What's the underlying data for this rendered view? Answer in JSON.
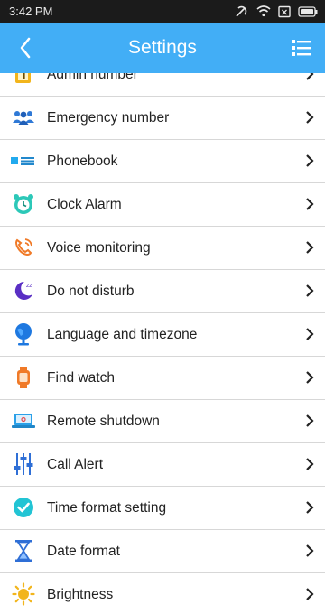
{
  "status_bar": {
    "time": "3:42 PM"
  },
  "header": {
    "title": "Settings"
  },
  "colors": {
    "accent": "#42aef6",
    "status_bar": "#1b1b1b"
  },
  "items": [
    {
      "label": "Admin number",
      "icon": "number-one-icon"
    },
    {
      "label": "Emergency number",
      "icon": "people-group-icon"
    },
    {
      "label": "Phonebook",
      "icon": "phonebook-icon"
    },
    {
      "label": "Clock Alarm",
      "icon": "alarm-clock-icon"
    },
    {
      "label": "Voice monitoring",
      "icon": "phone-ring-icon"
    },
    {
      "label": "Do not disturb",
      "icon": "moon-icon"
    },
    {
      "label": "Language and timezone",
      "icon": "globe-icon"
    },
    {
      "label": "Find watch",
      "icon": "watch-icon"
    },
    {
      "label": "Remote shutdown",
      "icon": "laptop-icon"
    },
    {
      "label": "Call Alert",
      "icon": "sliders-icon"
    },
    {
      "label": "Time format setting",
      "icon": "clock-check-icon"
    },
    {
      "label": "Date format",
      "icon": "hourglass-icon"
    },
    {
      "label": "Brightness",
      "icon": "sun-icon"
    }
  ]
}
